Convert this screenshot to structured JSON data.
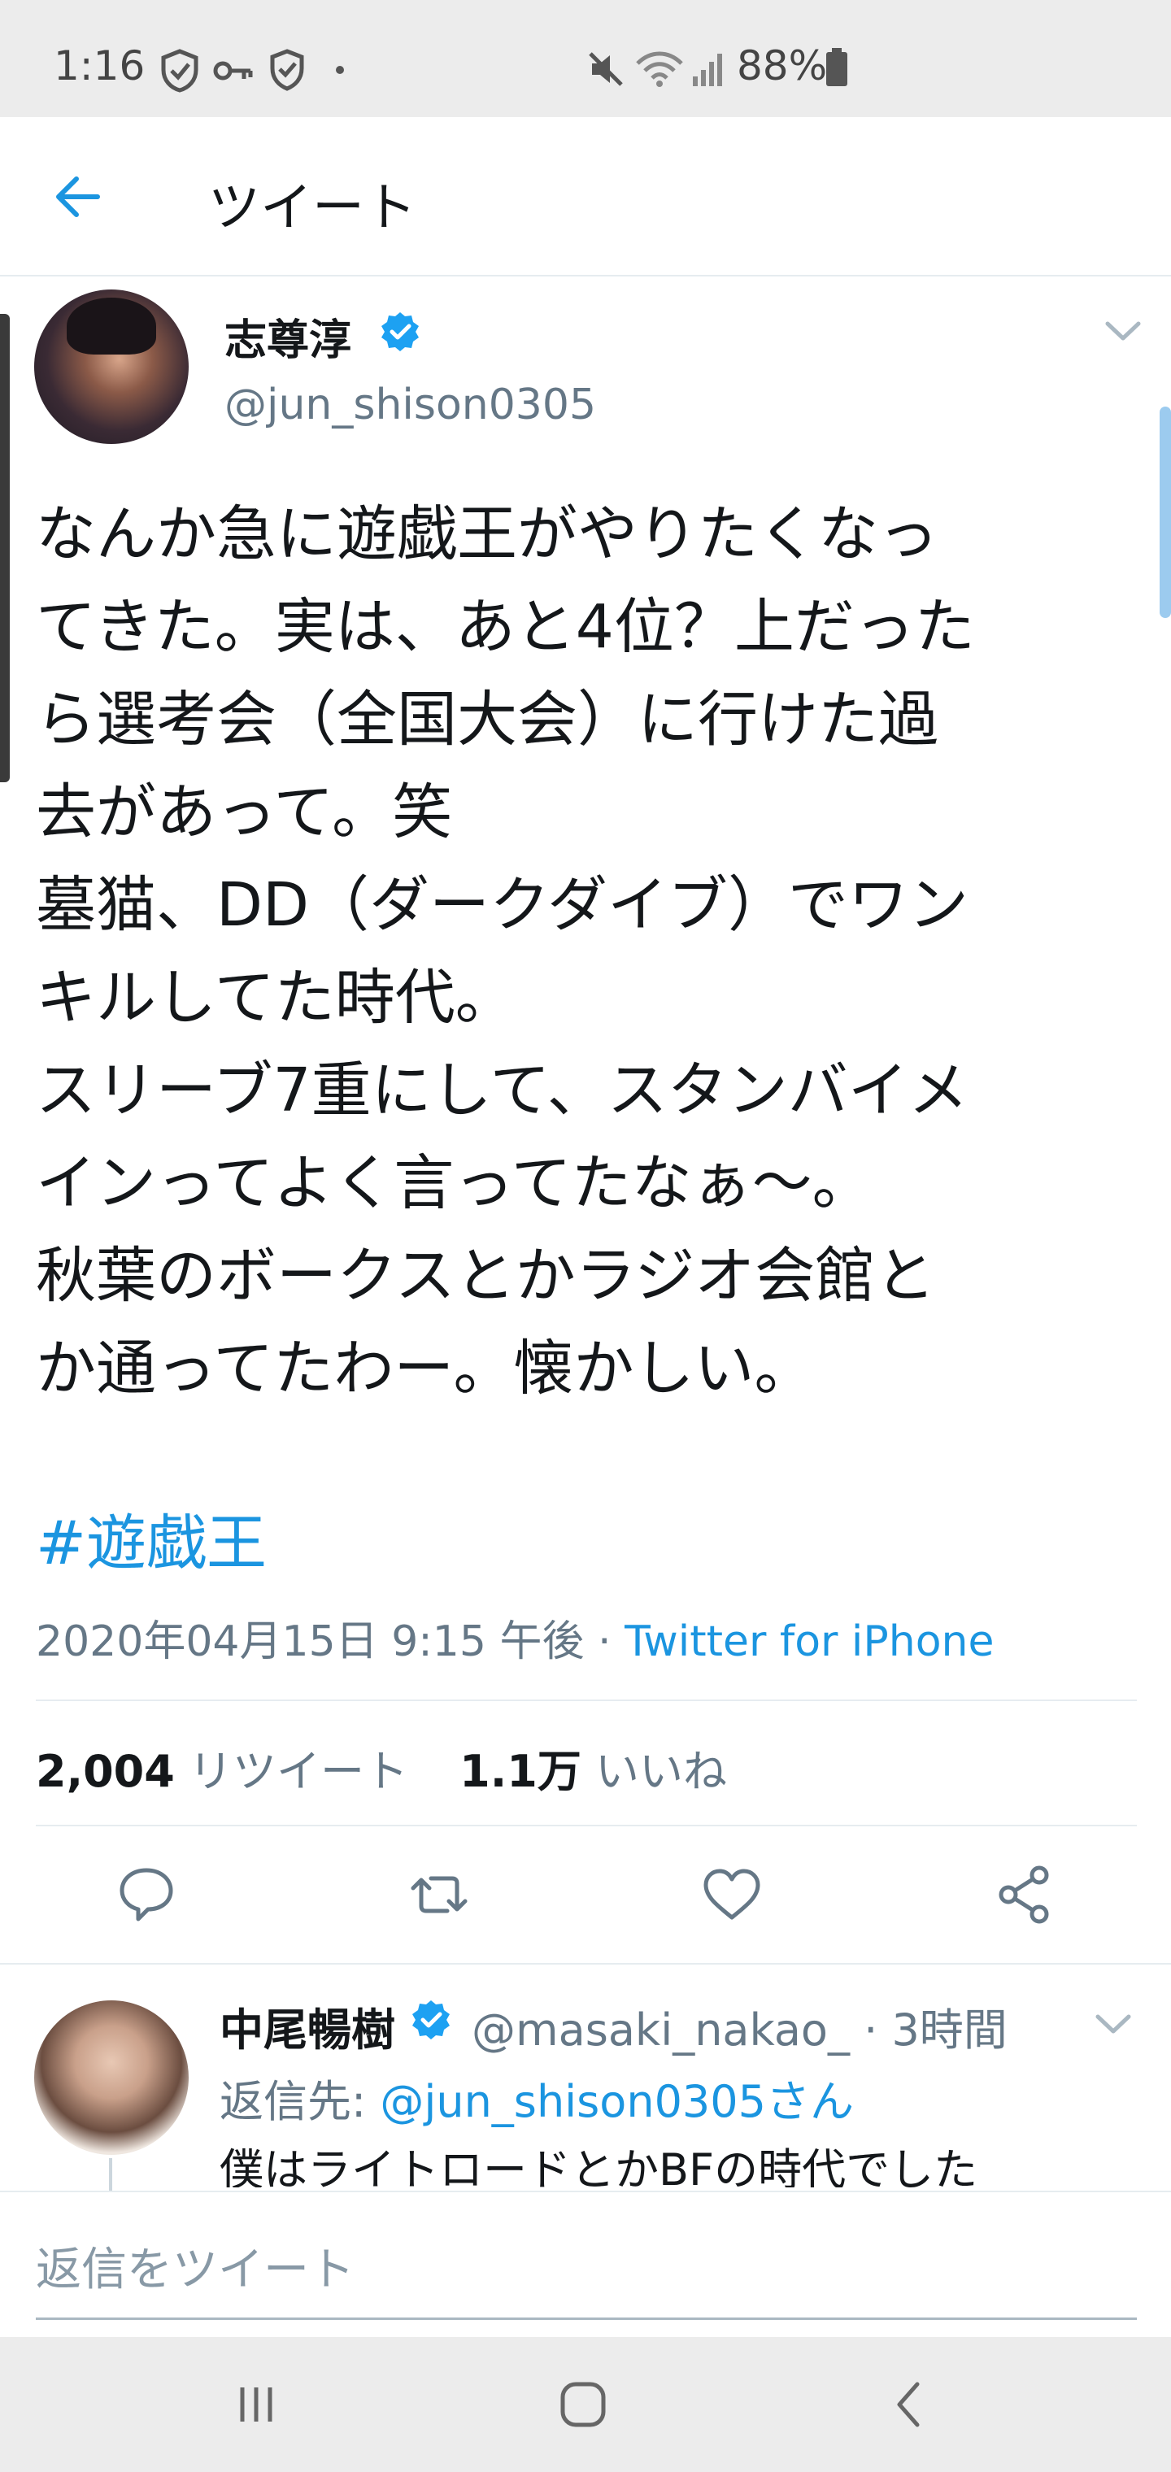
{
  "status_bar": {
    "time": "1:16",
    "battery": "88%",
    "icons": [
      "shield-check-icon",
      "key-icon",
      "shield-icon",
      "dot-icon",
      "mute-icon",
      "wifi-icon",
      "signal-icon",
      "battery-icon"
    ]
  },
  "header": {
    "title": "ツイート",
    "back_icon": "arrow-left-icon"
  },
  "tweet": {
    "author_name": "志尊淳",
    "author_handle": "@jun_shison0305",
    "verified": true,
    "text": "なんか急に遊戯王がやりたくなっ\nてきた。実は、あと4位？上だった\nら選考会（全国大会）に行けた過\n去があって。笑\n墓猫、DD（ダークダイブ）でワン\nキルしてた時代。\nスリーブ7重にして、スタンバイメ\nインってよく言ってたなぁ〜。\n秋葉のボークスとかラジオ会館と\nか通ってたわー。懐かしい。",
    "hashtag": "#遊戯王",
    "timestamp": "2020年04月15日 9:15 午後 · ",
    "source": "Twitter for iPhone",
    "retweets_count": "2,004",
    "retweets_label": "リツイート",
    "likes_count": "1.1万",
    "likes_label": "いいね"
  },
  "reply": {
    "author_name": "中尾暢樹",
    "author_handle": "@masaki_nakao_ · 3時間",
    "reply_to_label": "返信先: ",
    "reply_to_mention": "@jun_shison0305さん",
    "text": "僕はライトロードとかBFの時代でした"
  },
  "compose": {
    "placeholder": "返信をツイート"
  },
  "colors": {
    "accent": "#1b95e0",
    "secondary_text": "#657786",
    "primary_text": "#14171a",
    "divider": "#e6ecf0"
  }
}
